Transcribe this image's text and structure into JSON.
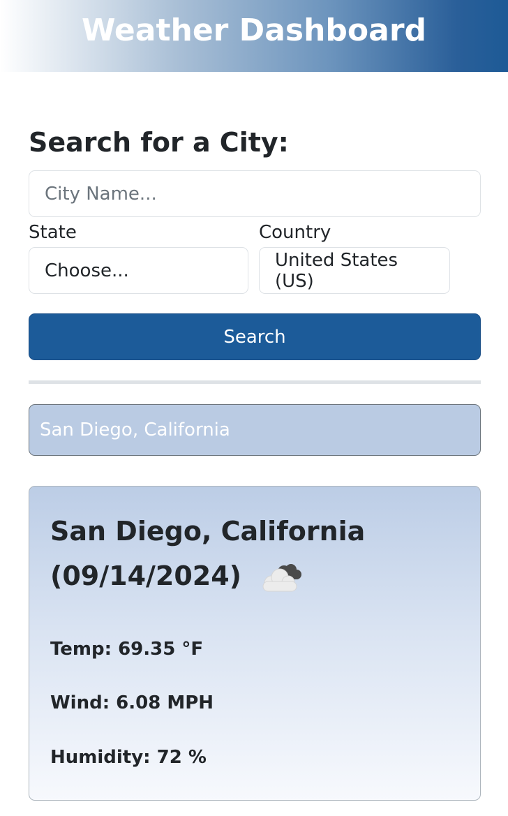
{
  "header": {
    "title": "Weather Dashboard"
  },
  "search": {
    "title": "Search for a City:",
    "city_placeholder": "City Name...",
    "city_value": "",
    "state_label": "State",
    "state_selected": "Choose...",
    "country_label": "Country",
    "country_selected": "United States (US)",
    "button_label": "Search"
  },
  "history": {
    "items": [
      {
        "label": "San Diego, California"
      }
    ]
  },
  "current": {
    "city": "San Diego, California",
    "date": "(09/14/2024)",
    "icon": "cloud-icon",
    "temp_label": "Temp: ",
    "temp_value": "69.35",
    "temp_unit": " °F",
    "wind_label": "Wind: ",
    "wind_value": "6.08",
    "wind_unit": " MPH",
    "humidity_label": "Humidity: ",
    "humidity_value": "72",
    "humidity_unit": " %"
  },
  "colors": {
    "primary": "#1c5b99",
    "history_bg": "#bacbe3",
    "text": "#212529"
  }
}
